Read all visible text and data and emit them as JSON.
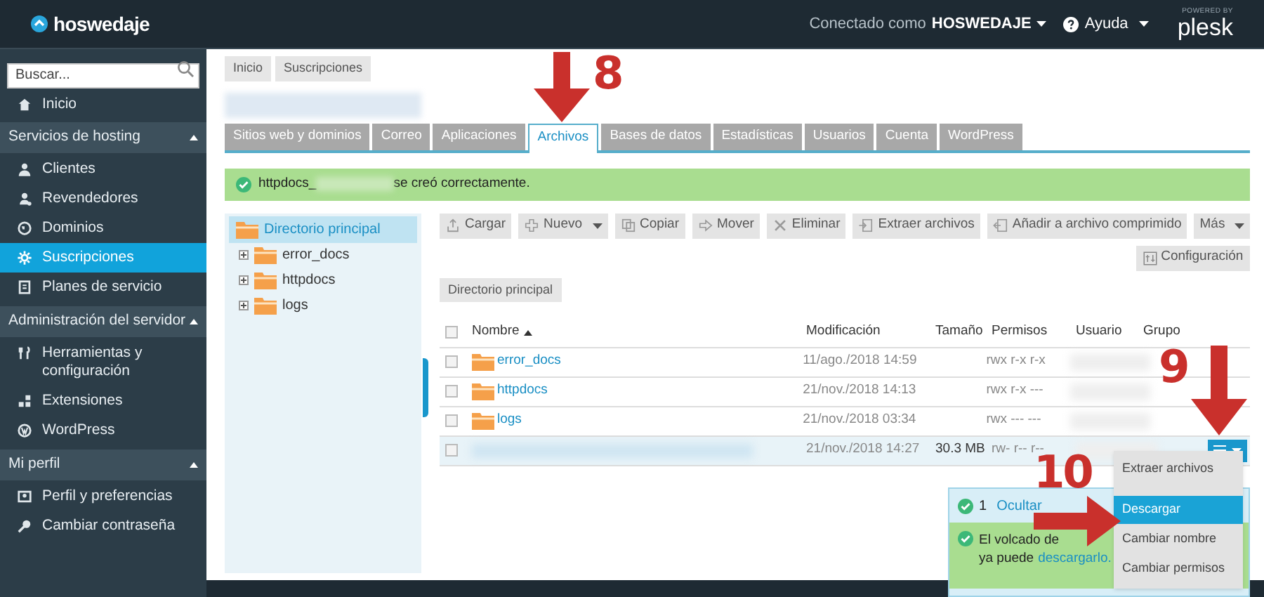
{
  "header": {
    "logo": "hoswedaje",
    "connected_label": "Conectado como",
    "user": "HOSWEDAJE",
    "help": "Ayuda",
    "powered_by": "POWERED BY",
    "brand": "plesk"
  },
  "sidebar": {
    "search": {
      "placeholder": "Buscar..."
    },
    "top_items": [
      {
        "label": "Inicio",
        "selected": false
      }
    ],
    "sections": [
      {
        "title": "Servicios de hosting",
        "expanded": true,
        "items": [
          {
            "label": "Clientes",
            "selected": false
          },
          {
            "label": "Revendedores",
            "selected": false
          },
          {
            "label": "Dominios",
            "selected": false
          },
          {
            "label": "Suscripciones",
            "selected": true
          },
          {
            "label": "Planes de servicio",
            "selected": false
          }
        ]
      },
      {
        "title": "Administración del servidor",
        "expanded": true,
        "items": [
          {
            "label": "Herramientas y configuración",
            "selected": false
          },
          {
            "label": "Extensiones",
            "selected": false
          },
          {
            "label": "WordPress",
            "selected": false
          }
        ]
      },
      {
        "title": "Mi perfil",
        "expanded": true,
        "items": [
          {
            "label": "Perfil y preferencias",
            "selected": false
          },
          {
            "label": "Cambiar contraseña",
            "selected": false
          }
        ]
      }
    ]
  },
  "breadcrumbs": [
    "Inicio",
    "Suscripciones"
  ],
  "tabs": [
    {
      "label": "Sitios web y dominios",
      "selected": false
    },
    {
      "label": "Correo",
      "selected": false
    },
    {
      "label": "Aplicaciones",
      "selected": false
    },
    {
      "label": "Archivos",
      "selected": true
    },
    {
      "label": "Bases de datos",
      "selected": false
    },
    {
      "label": "Estadísticas",
      "selected": false
    },
    {
      "label": "Usuarios",
      "selected": false
    },
    {
      "label": "Cuenta",
      "selected": false
    },
    {
      "label": "WordPress",
      "selected": false
    }
  ],
  "success_message": {
    "prefix": "httpdocs_",
    "suffix": "se creó correctamente."
  },
  "tree": {
    "root": {
      "label": "Directorio principal",
      "selected": true
    },
    "children": [
      {
        "label": "error_docs",
        "expanded": false
      },
      {
        "label": "httpdocs",
        "expanded": false
      },
      {
        "label": "logs",
        "expanded": false
      }
    ]
  },
  "toolbar": [
    {
      "label": "Cargar",
      "dropdown": false
    },
    {
      "label": "Nuevo",
      "dropdown": true
    },
    {
      "label": "Copiar",
      "dropdown": false
    },
    {
      "label": "Mover",
      "dropdown": false
    },
    {
      "label": "Eliminar",
      "dropdown": false
    },
    {
      "label": "Extraer archivos",
      "dropdown": false
    },
    {
      "label": "Añadir a archivo comprimido",
      "dropdown": false
    },
    {
      "label": "Más",
      "dropdown": true
    }
  ],
  "settings_button": "Configuración",
  "path": "Directorio principal",
  "table": {
    "columns": [
      "Nombre",
      "Modificación",
      "Tamaño",
      "Permisos",
      "Usuario",
      "Grupo"
    ],
    "all_checked": false,
    "rows": [
      {
        "kind": "folder",
        "name": "error_docs",
        "modified": "11/ago./2018 14:59",
        "size": "",
        "permissions": "rwx r-x r-x",
        "checked": false,
        "selected": false
      },
      {
        "kind": "folder",
        "name": "httpdocs",
        "modified": "21/nov./2018 14:13",
        "size": "",
        "permissions": "rwx r-x ---",
        "checked": false,
        "selected": false
      },
      {
        "kind": "folder",
        "name": "logs",
        "modified": "21/nov./2018 03:34",
        "size": "",
        "permissions": "rwx --- ---",
        "checked": false,
        "selected": false
      },
      {
        "kind": "file",
        "name": "",
        "modified": "21/nov./2018 14:27",
        "size": "30.3 MB",
        "permissions": "rw- r-- r--",
        "checked": false,
        "selected": true
      }
    ]
  },
  "context_menu": [
    {
      "label": "Extraer archivos",
      "selected": false
    },
    {
      "label": "Descargar",
      "selected": true
    },
    {
      "label": "Cambiar nombre",
      "selected": false
    },
    {
      "label": "Cambiar permisos",
      "selected": false
    }
  ],
  "notification": {
    "count": "1",
    "hide_link": "Ocultar",
    "message_line1": "El volcado de",
    "message_line2": "ya puede",
    "link": "descargarlo."
  },
  "annotations": [
    {
      "kind": "down",
      "number": "8"
    },
    {
      "kind": "down",
      "number": "9"
    },
    {
      "kind": "right",
      "number": "10"
    }
  ]
}
